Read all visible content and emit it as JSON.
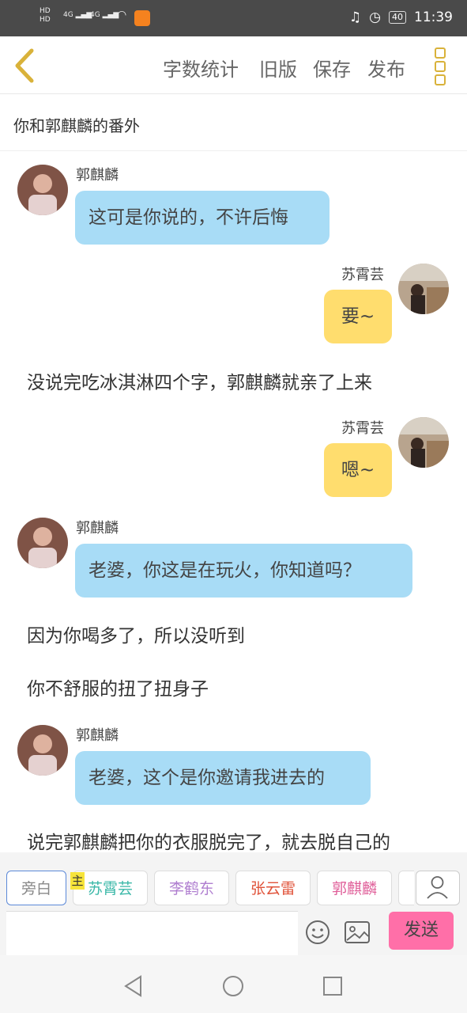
{
  "status_bar": {
    "hd1": "HD",
    "hd2": "HD",
    "sig1": "4G",
    "sig2": "4G",
    "battery": "40",
    "time": "11:39"
  },
  "toolbar": {
    "word_count": "字数统计",
    "old_version": "旧版",
    "save": "保存",
    "publish": "发布"
  },
  "story_title": "你和郭麒麟的番外",
  "messages": [
    {
      "type": "left",
      "name": "郭麒麟",
      "text": "这可是你说的，不许后悔"
    },
    {
      "type": "right",
      "name": "苏霄芸",
      "text": "要~"
    },
    {
      "type": "narration",
      "text": "没说完吃冰淇淋四个字，郭麒麟就亲了上来"
    },
    {
      "type": "right",
      "name": "苏霄芸",
      "text": "嗯~"
    },
    {
      "type": "left",
      "name": "郭麒麟",
      "text": "老婆，你这是在玩火，你知道吗？"
    },
    {
      "type": "narration",
      "text": "因为你喝多了，所以没听到"
    },
    {
      "type": "narration",
      "text": "你不舒服的扭了扭身子"
    },
    {
      "type": "left",
      "name": "郭麒麟",
      "text": "老婆，这个是你邀请我进去的"
    },
    {
      "type": "narration",
      "text": "说完郭麒麟把你的衣服脱完了，就去脱自己的"
    }
  ],
  "characters": [
    {
      "label": "旁白",
      "color": "#888888"
    },
    {
      "label": "苏霄芸",
      "color": "#3bb8a8"
    },
    {
      "label": "李鹤东",
      "color": "#b07fd0"
    },
    {
      "label": "张云雷",
      "color": "#e0533a"
    },
    {
      "label": "郭麒麟",
      "color": "#e0609a"
    }
  ],
  "main_tag": "主",
  "send_label": "发送",
  "colors": {
    "left_bubble": "#a8dcf6",
    "right_bubble": "#ffdd6e",
    "accent": "#d9b23a",
    "send": "#ff6fa8"
  },
  "icons": [
    "back-chevron-icon",
    "more-menu-icon",
    "person-icon",
    "emoji-icon",
    "image-icon",
    "nav-back-icon",
    "nav-home-icon",
    "nav-recent-icon"
  ]
}
